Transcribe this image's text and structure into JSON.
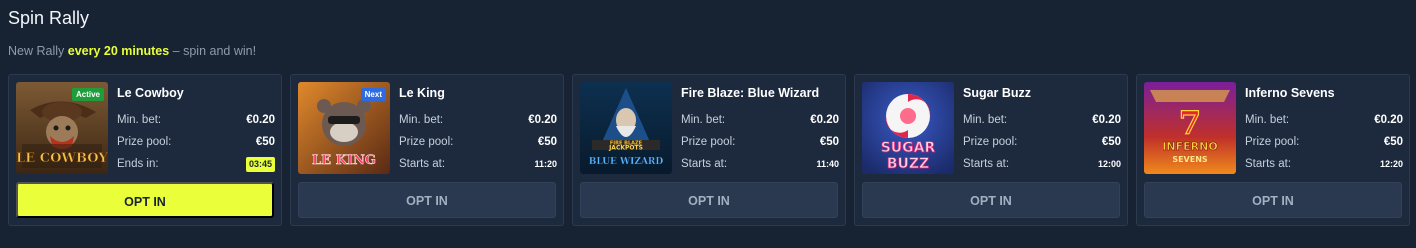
{
  "header": {
    "title": "Spin Rally",
    "subtitle_prefix": "New Rally ",
    "subtitle_highlight": "every 20 minutes",
    "subtitle_suffix": " – spin and win!"
  },
  "labels": {
    "min_bet": "Min. bet:",
    "prize_pool": "Prize pool:",
    "ends_in": "Ends in:",
    "starts_at": "Starts at:"
  },
  "colors": {
    "accent": "#eaff3a",
    "active_badge": "#1f9d3a",
    "next_badge": "#2f6be0",
    "background": "#172232",
    "card": "#1d2a3d"
  },
  "cards": [
    {
      "name": "Le Cowboy",
      "badge": "Active",
      "thumb_icon": "le-cowboy-game-art",
      "thumb_text": "LE COWBOY",
      "min_bet": "€0.20",
      "prize_pool": "€50",
      "time": "03:45",
      "button": "OPT IN"
    },
    {
      "name": "Le King",
      "badge": "Next",
      "thumb_icon": "le-king-game-art",
      "thumb_text": "LE KING",
      "min_bet": "€0.20",
      "prize_pool": "€50",
      "time": "11:20",
      "button": "OPT IN"
    },
    {
      "name": "Fire Blaze: Blue Wizard",
      "thumb_icon": "blue-wizard-game-art",
      "thumb_text_1": "FIRE BLAZE",
      "thumb_text_2": "JACKPOTS",
      "thumb_text_3": "BLUE WIZARD",
      "min_bet": "€0.20",
      "prize_pool": "€50",
      "time": "11:40",
      "button": "OPT IN"
    },
    {
      "name": "Sugar Buzz",
      "thumb_icon": "sugar-buzz-game-art",
      "thumb_text_1": "SUGAR",
      "thumb_text_2": "BUZZ",
      "min_bet": "€0.20",
      "prize_pool": "€50",
      "time": "12:00",
      "button": "OPT IN"
    },
    {
      "name": "Inferno Sevens",
      "thumb_icon": "inferno-sevens-game-art",
      "thumb_text_1": "INFERNO",
      "thumb_text_2": "SEVENS",
      "min_bet": "€0.20",
      "prize_pool": "€50",
      "time": "12:20",
      "button": "OPT IN"
    }
  ]
}
